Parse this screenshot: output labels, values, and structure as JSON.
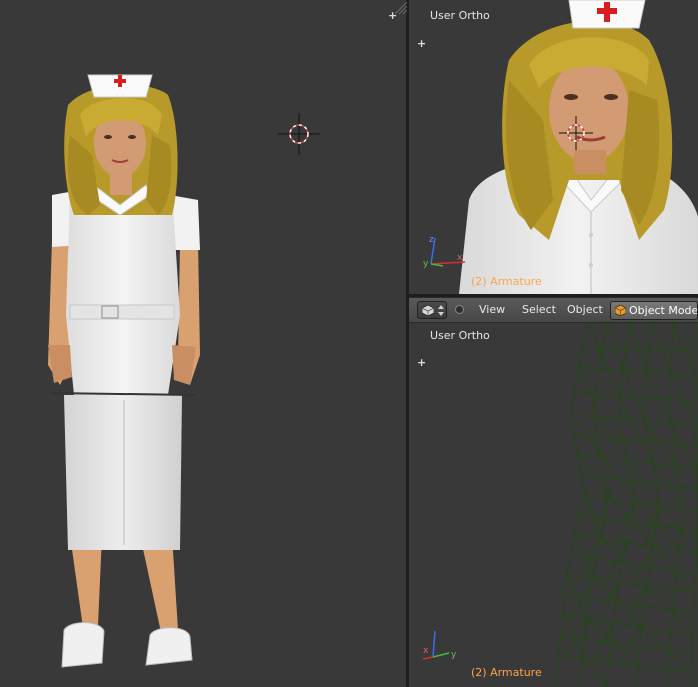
{
  "viewports": {
    "left": {
      "label": ""
    },
    "top_right": {
      "view_label": "User Ortho",
      "object_label": "(2) Armature"
    },
    "bottom_right": {
      "view_label": "User Ortho",
      "object_label": "(2) Armature"
    }
  },
  "header": {
    "menus": [
      "View",
      "Select",
      "Object"
    ],
    "mode": "Object Mode"
  },
  "icons": {
    "editor_type": "3d-view-icon",
    "cursor": "3d-cursor-icon",
    "axes": "axis-gizmo-icon"
  },
  "colors": {
    "viewport_bg": "#393939",
    "object_label": "#ffa34a",
    "wireframe": "#1f4a12",
    "cursor_ring": "#d43f3f"
  }
}
